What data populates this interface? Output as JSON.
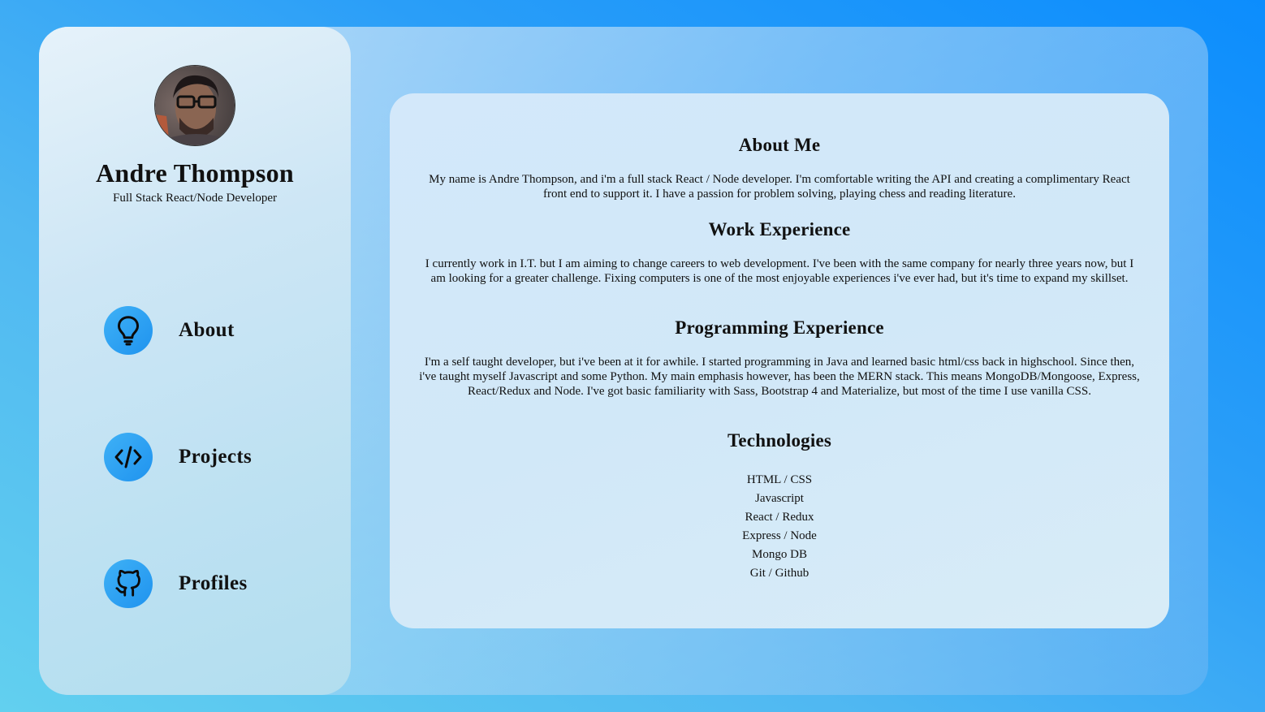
{
  "sidebar": {
    "name": "Andre Thompson",
    "role": "Full Stack React/Node Developer",
    "nav": [
      {
        "label": "About",
        "icon": "lightbulb-icon"
      },
      {
        "label": "Projects",
        "icon": "code-icon"
      },
      {
        "label": "Profiles",
        "icon": "github-icon"
      }
    ]
  },
  "content": {
    "about_title": "About Me",
    "about_text": "My name is Andre Thompson, and i'm a full stack React / Node developer. I'm comfortable writing the API and creating a complimentary React front end to support it. I have a passion for problem solving, playing chess and reading literature.",
    "work_title": "Work Experience",
    "work_text": "I currently work in I.T. but I am aiming to change careers to web development. I've been with the same company for nearly three years now, but I am looking for a greater challenge. Fixing computers is one of the most enjoyable experiences i've ever had, but it's time to expand my skillset.",
    "programming_title": "Programming Experience",
    "programming_text": "I'm a self taught developer, but i've been at it for awhile. I started programming in Java and learned basic html/css back in highschool. Since then, i've taught myself Javascript and some Python. My main emphasis however, has been the MERN stack. This means MongoDB/Mongoose, Express, React/Redux and Node. I've got basic familiarity with Sass, Bootstrap 4 and Materialize, but most of the time I use vanilla CSS.",
    "tech_title": "Technologies",
    "technologies": [
      "HTML / CSS",
      "Javascript",
      "React / Redux",
      "Express / Node",
      "Mongo DB",
      "Git / Github"
    ]
  },
  "colors": {
    "accent": "#1f93ef",
    "background": "#2a9ef8"
  }
}
